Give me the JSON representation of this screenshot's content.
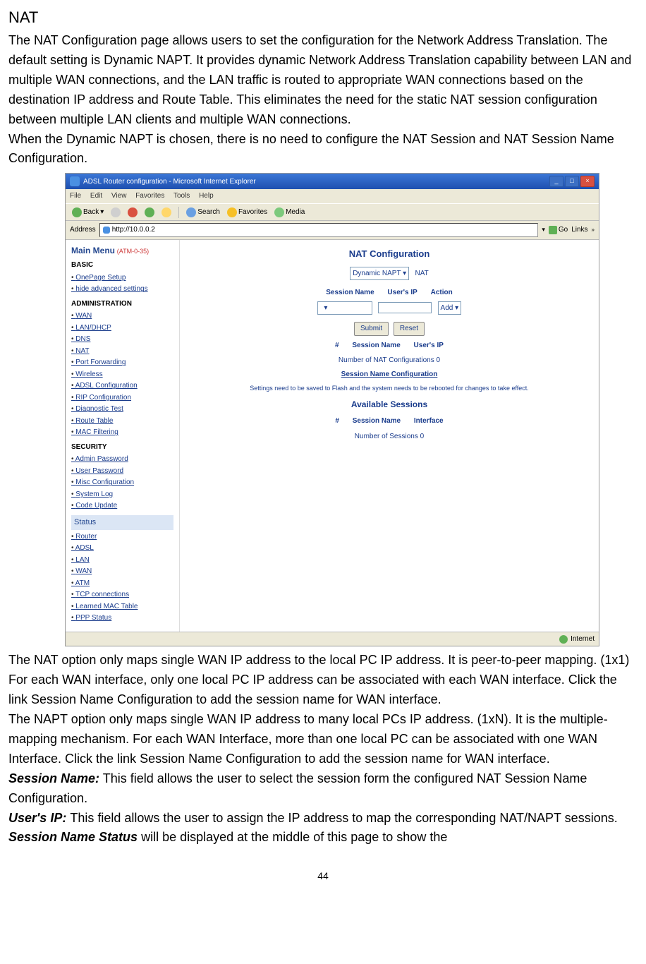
{
  "title": "NAT",
  "para1": "The NAT Configuration page allows users to set the configuration for the Network Address Translation. The default setting is Dynamic NAPT. It provides dynamic Network Address Translation capability between LAN and multiple WAN connections, and the LAN traffic is routed to appropriate WAN connections based on the destination IP address and Route Table. This eliminates the need for the static NAT session configuration between multiple LAN clients and multiple WAN connections.",
  "para2": "When the Dynamic NAPT is chosen, there is no need to configure the NAT Session and NAT Session Name Configuration.",
  "ie": {
    "windowTitle": "ADSL Router configuration - Microsoft Internet Explorer",
    "menu": {
      "file": "File",
      "edit": "Edit",
      "view": "View",
      "favorites": "Favorites",
      "tools": "Tools",
      "help": "Help"
    },
    "toolbar": {
      "back": "Back",
      "search": "Search",
      "favorites": "Favorites",
      "media": "Media"
    },
    "addressLabel": "Address",
    "url": "http://10.0.0.2",
    "go": "Go",
    "links": "Links",
    "statusInternet": "Internet"
  },
  "sidebar": {
    "mainMenu": "Main Menu",
    "mainMenuSub": "(ATM-0-35)",
    "basicHdr": "BASIC",
    "basic": [
      "OnePage Setup",
      "hide advanced settings"
    ],
    "adminHdr": "ADMINISTRATION",
    "admin": [
      "WAN",
      "LAN/DHCP",
      "DNS",
      "NAT",
      "Port Forwarding",
      "Wireless",
      "ADSL Configuration",
      "RIP Configuration",
      "Diagnostic Test",
      "Route Table",
      "MAC Filtering"
    ],
    "securityHdr": "SECURITY",
    "security": [
      "Admin Password",
      "User Password",
      "Misc Configuration",
      "System Log",
      "Code Update"
    ],
    "statusHdr": "Status",
    "status": [
      "Router",
      "ADSL",
      "LAN",
      "WAN",
      "ATM",
      "TCP connections",
      "Learned MAC Table",
      "PPP Status"
    ]
  },
  "nat": {
    "pageTitle": "NAT Configuration",
    "typeSel": "Dynamic NAPT",
    "natLabel": "NAT",
    "hdr_session": "Session Name",
    "hdr_userip": "User's IP",
    "hdr_action": "Action",
    "actionSel": "Add",
    "submit": "Submit",
    "reset": "Reset",
    "col_num": "#",
    "col_session": "Session Name",
    "col_userip": "User's IP",
    "numConfigs": "Number of NAT Configurations 0",
    "sessLink": "Session Name Configuration",
    "noteText": "Settings need to be saved to Flash and the system needs to be rebooted for changes to take effect.",
    "availHdr": "Available Sessions",
    "col2_num": "#",
    "col2_session": "Session Name",
    "col2_interface": "Interface",
    "numSessions": "Number of Sessions 0"
  },
  "para3": "The NAT option only maps single WAN IP address to the local PC IP address. It is peer-to-peer mapping. (1x1) For each WAN interface, only one local PC IP address can be associated with each WAN interface. Click the link Session Name Configuration to add the session name for WAN interface.",
  "para4": "The NAPT option only maps single WAN IP address to many local PCs IP address. (1xN). It is the multiple-mapping mechanism. For each WAN Interface, more than one local PC can be associated with one WAN Interface. Click the link Session Name Configuration to add the session name for WAN interface.",
  "def_session_label": "Session Name:",
  "def_session_text": " This field allows the user to select the session form the configured NAT Session Name Configuration.",
  "def_userip_label": "User's IP",
  "def_userip_colon": ": ",
  "def_userip_text": "This field allows the user to assign the IP address to map the corresponding NAT/NAPT sessions.",
  "def_status_label": "Session Name Status",
  "def_status_text": " will be displayed at the middle of this page to show the",
  "pageNum": "44"
}
